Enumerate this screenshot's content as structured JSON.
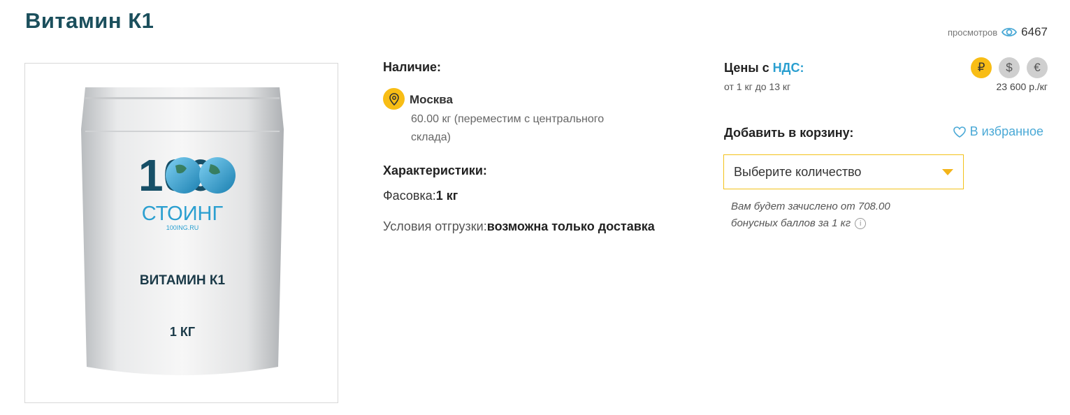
{
  "page": {
    "title": "Витамин К1"
  },
  "views": {
    "label": "просмотров",
    "count": "6467"
  },
  "product_image": {
    "brand_number": "100",
    "brand_name": "СТОИНГ",
    "brand_site": "100ING.RU",
    "label_name": "ВИТАМИН К1",
    "label_weight": "1 КГ"
  },
  "availability": {
    "label": "Наличие:",
    "city": "Москва",
    "stock": "60.00 кг (переместим с центрального склада)"
  },
  "characteristics": {
    "label": "Характеристики:",
    "packing_key": "Фасовка:",
    "packing_value": "1 кг",
    "shipping_key": "Условия отгрузки:",
    "shipping_value": "возможна только доставка"
  },
  "prices": {
    "label_prefix": "Цены с ",
    "label_nds": "НДС:",
    "range": "от 1 кг до 13 кг",
    "value": "23 600 р./кг",
    "currencies": [
      {
        "symbol": "₽",
        "active": true
      },
      {
        "symbol": "$",
        "active": false
      },
      {
        "symbol": "€",
        "active": false
      }
    ]
  },
  "cart": {
    "label": "Добавить в корзину:",
    "favorite_label": "В избранное",
    "select_placeholder": "Выберите количество",
    "bonus_line1": "Вам будет зачислено от 708.00",
    "bonus_line2": "бонусных баллов за 1 кг",
    "info_symbol": "i"
  },
  "colors": {
    "accent": "#f8bd15",
    "title": "#1b4f5c",
    "link": "#2a9fd0"
  }
}
